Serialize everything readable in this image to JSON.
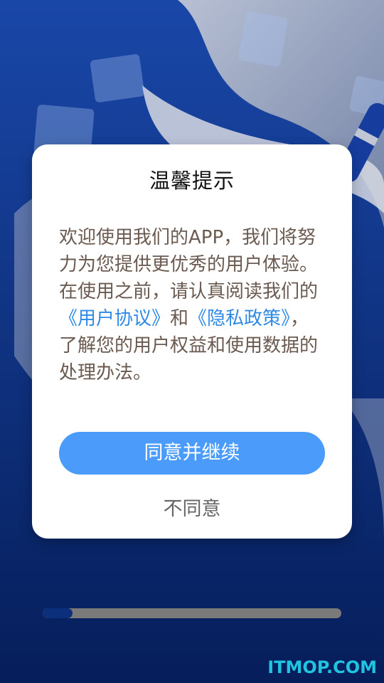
{
  "dialog": {
    "title": "温馨提示",
    "body": {
      "text_before": "欢迎使用我们的APP，我们将努力为您提供更优秀的用户体验。在使用之前，请认真阅读我们的",
      "user_agreement_link": "《用户协议》",
      "and": "和",
      "privacy_policy_link": "《隐私政策》",
      "text_after": "，了解您的用户权益和使用数据的处理办法。"
    },
    "agree_button_label": "同意并继续",
    "disagree_button_label": "不同意"
  },
  "progress": {
    "value_fraction": 0.1
  },
  "watermark": "ITMOP.COM",
  "colors": {
    "background": "#0a2a73",
    "accent": "#4a9bfa",
    "link": "#2f8ae6"
  }
}
